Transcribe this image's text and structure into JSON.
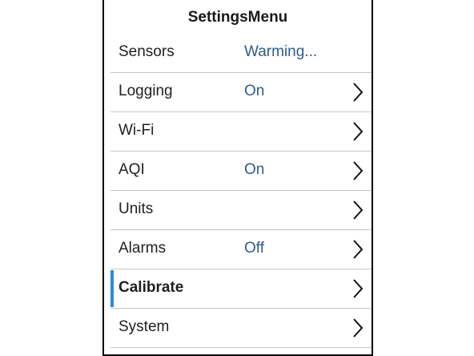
{
  "screen": {
    "title": "SettingsMenu"
  },
  "menu": {
    "selected_index": 6,
    "accent_color": "#2e8ad6",
    "value_color": "#2e5d8a",
    "items": [
      {
        "label": "Sensors",
        "value": "Warming...",
        "chevron": false
      },
      {
        "label": "Logging",
        "value": "On",
        "chevron": true
      },
      {
        "label": "Wi-Fi",
        "value": "",
        "chevron": true
      },
      {
        "label": "AQI",
        "value": "On",
        "chevron": true
      },
      {
        "label": "Units",
        "value": "",
        "chevron": true
      },
      {
        "label": "Alarms",
        "value": "Off",
        "chevron": true
      },
      {
        "label": "Calibrate",
        "value": "",
        "chevron": true
      },
      {
        "label": "System",
        "value": "",
        "chevron": true
      }
    ]
  },
  "icons": {
    "chevron": "chevron-right-icon"
  }
}
